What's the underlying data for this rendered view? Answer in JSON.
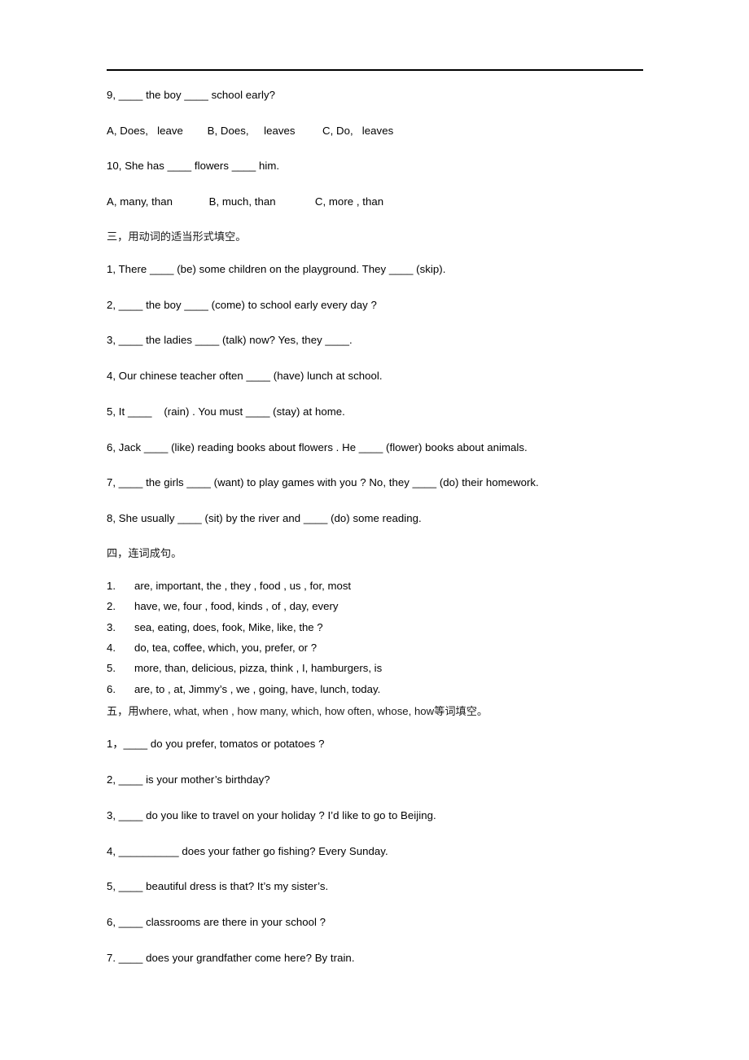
{
  "document": {
    "header_rule": true,
    "sections": [
      {
        "id": "mc-continued",
        "items": [
          {
            "type": "question",
            "text": "9, ____ the boy ____ school early?"
          },
          {
            "type": "options",
            "text": "A, Does,   leave        B, Does,     leaves         C, Do,   leaves"
          },
          {
            "type": "question",
            "text": "10, She has ____ flowers ____ him."
          },
          {
            "type": "options",
            "text": "A, many, than            B, much, than             C, more , than"
          }
        ]
      },
      {
        "id": "section-three",
        "heading": "三，用动词的适当形式填空。",
        "items": [
          {
            "type": "question",
            "text": "1, There ____ (be) some children on the playground. They ____ (skip)."
          },
          {
            "type": "question",
            "text": "2, ____ the boy ____ (come) to school early every day ?"
          },
          {
            "type": "question",
            "text": "3, ____ the ladies ____ (talk) now? Yes, they ____."
          },
          {
            "type": "question",
            "text": "4, Our chinese teacher often ____ (have) lunch at school."
          },
          {
            "type": "question",
            "text": "5, It ____    (rain) . You must ____ (stay) at home."
          },
          {
            "type": "question",
            "text": "6, Jack ____ (like) reading books about flowers . He ____ (flower) books about animals."
          },
          {
            "type": "question",
            "text": "7, ____ the girls ____ (want) to play games with you ? No, they ____ (do) their homework."
          },
          {
            "type": "question",
            "text": "8, She usually ____ (sit) by the river and ____ (do) some reading."
          }
        ]
      },
      {
        "id": "section-four",
        "heading": "四，连词成句。",
        "list": [
          {
            "num": "1.",
            "text": "are, important, the , they , food , us , for, most"
          },
          {
            "num": "2.",
            "text": "have, we, four , food, kinds , of , day, every"
          },
          {
            "num": "3.",
            "text": "sea, eating, does, fook, Mike, like, the ?"
          },
          {
            "num": "4.",
            "text": "do, tea, coffee, which, you, prefer, or ?"
          },
          {
            "num": "5.",
            "text": "more, than, delicious, pizza, think , I, hamburgers, is"
          },
          {
            "num": "6.",
            "text": "are, to , at, Jimmy’s , we , going, have, lunch, today."
          }
        ]
      },
      {
        "id": "section-five",
        "heading_prefix": "五，用",
        "heading_words": "where, what, when , how many, which, how often, whose, how",
        "heading_suffix": "等词填空。",
        "items": [
          {
            "type": "question",
            "text": "1，____ do you prefer, tomatos or potatoes ?"
          },
          {
            "type": "question",
            "text": "2, ____ is your mother’s birthday?"
          },
          {
            "type": "question",
            "text": "3, ____ do you like to travel on your holiday ? I’d like to go to Beijing."
          },
          {
            "type": "question",
            "text": "4, __________ does your father go fishing? Every Sunday."
          },
          {
            "type": "question",
            "text": "5, ____ beautiful dress is that? It’s my sister’s."
          },
          {
            "type": "question",
            "text": "6, ____ classrooms are there in your school ?"
          },
          {
            "type": "question",
            "text": "7. ____ does your grandfather come here? By train."
          }
        ]
      }
    ]
  }
}
